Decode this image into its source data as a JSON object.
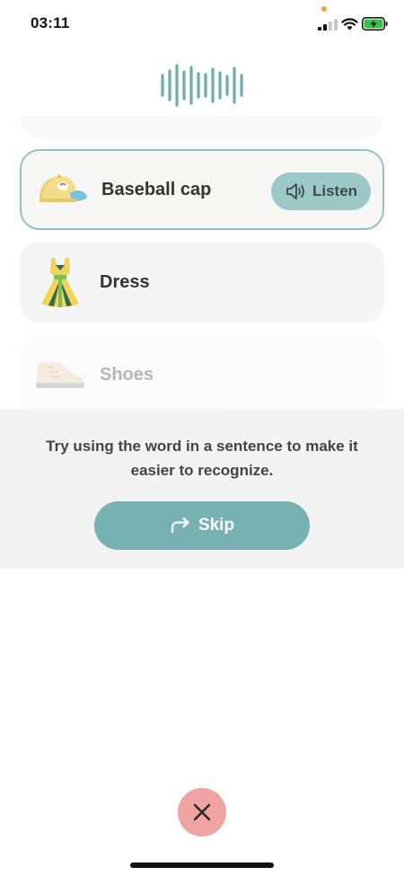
{
  "status_bar": {
    "time": "03:11",
    "icons": [
      "signal-icon",
      "wifi-icon",
      "battery-charging-icon"
    ],
    "privacy_dot_color": "#f0a040"
  },
  "waveform": {
    "icon": "waveform-icon",
    "color": "#6aaeae"
  },
  "words": [
    {
      "label": "Baseball cap",
      "icon": "baseball-cap-icon",
      "state": "active",
      "listen_label": "Listen"
    },
    {
      "label": "Dress",
      "icon": "dress-icon",
      "state": "normal"
    },
    {
      "label": "Shoes",
      "icon": "shoe-icon",
      "state": "faded"
    }
  ],
  "hint": {
    "text": "Try using the word in a sentence to make it easier to recognize.",
    "skip_label": "Skip",
    "skip_icon": "redo-arrow-icon"
  },
  "close": {
    "icon": "close-icon",
    "color": "#f0a3a3"
  },
  "colors": {
    "accent": "#77b1b1",
    "active_border": "#8ec3c1",
    "listen_bg": "#9dc8c8"
  }
}
